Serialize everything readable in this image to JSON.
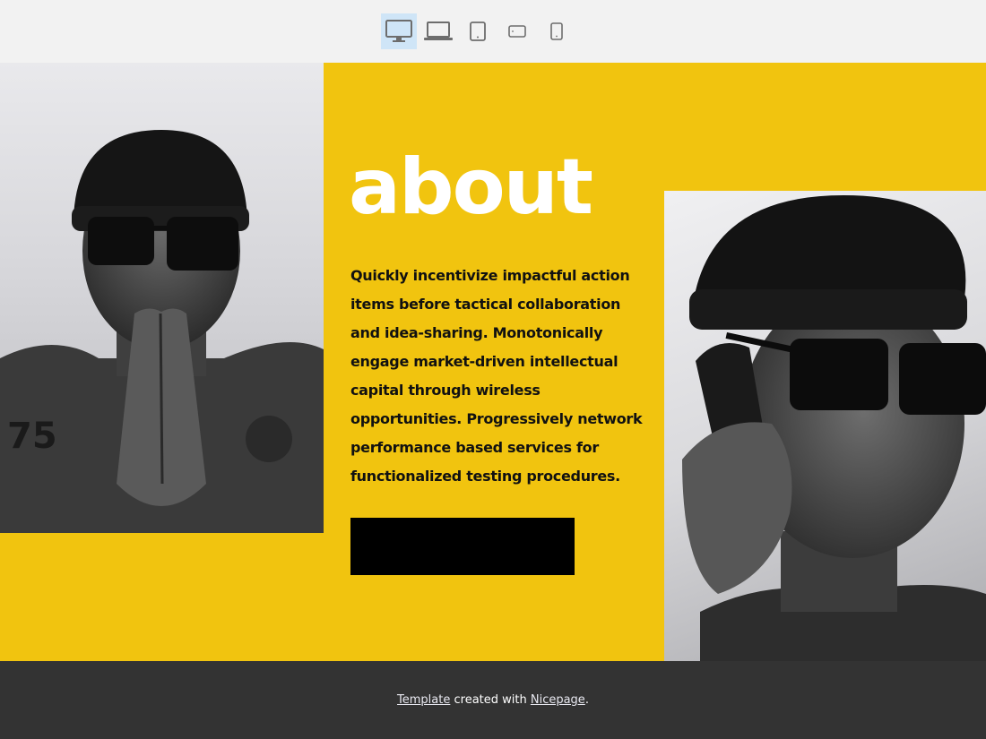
{
  "device_toolbar": {
    "items": [
      {
        "name": "desktop",
        "active": true
      },
      {
        "name": "laptop",
        "active": false
      },
      {
        "name": "tablet",
        "active": false
      },
      {
        "name": "phone-landscape",
        "active": false
      },
      {
        "name": "phone-portrait",
        "active": false
      }
    ]
  },
  "colors": {
    "accent_yellow": "#f1c40f",
    "footer_bg": "#333333",
    "active_device_bg": "#cfe5f7"
  },
  "about": {
    "title": "about",
    "body": "Quickly incentivize impactful action items before tactical collaboration and idea-sharing. Monotonically engage market-driven intellectual capital through wireless opportunities. Progressively network performance based services for functionalized testing procedures.",
    "button_label": ""
  },
  "images": {
    "left": "black-and-white portrait of a man in a beanie and sunglasses with hands pressed together",
    "right": "black-and-white portrait of a man in a beanie and sunglasses talking on a phone"
  },
  "footer": {
    "template_link": "Template",
    "middle_text": " created with ",
    "nicepage_link": "Nicepage",
    "end_text": "."
  }
}
